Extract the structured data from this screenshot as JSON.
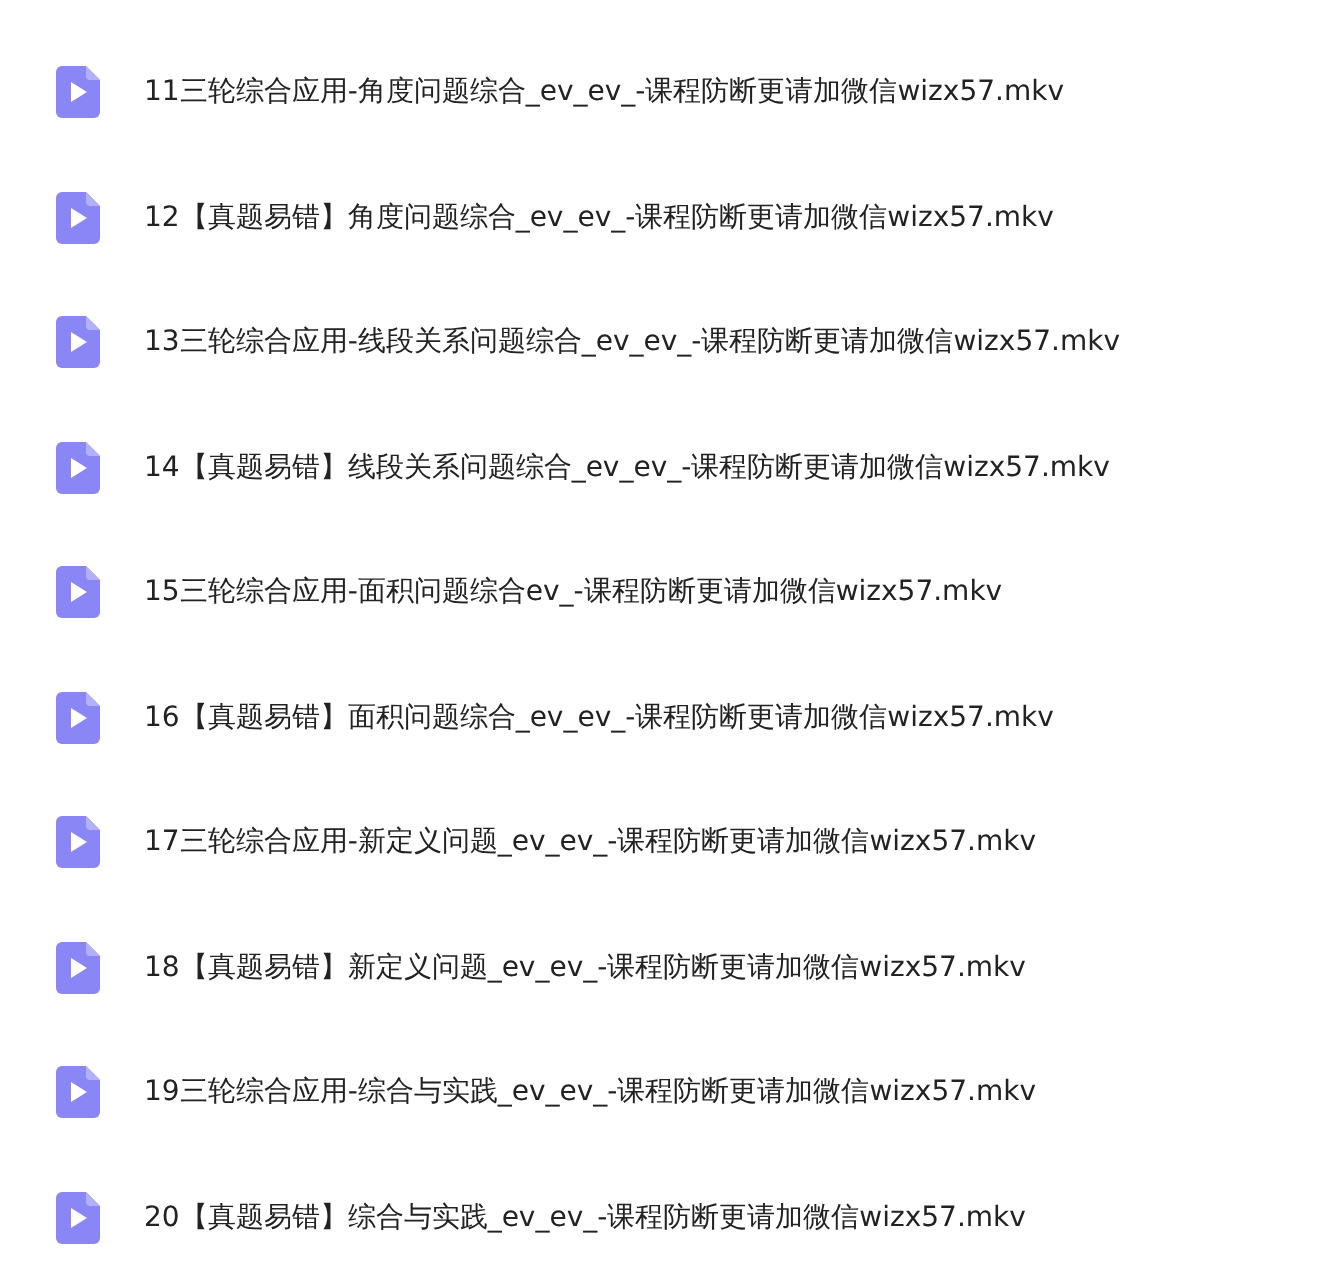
{
  "files": [
    {
      "name": "11三轮综合应用-角度问题综合_ev_ev_-课程防断更请加微信wizx57.mkv",
      "kind": "video"
    },
    {
      "name": "12【真题易错】角度问题综合_ev_ev_-课程防断更请加微信wizx57.mkv",
      "kind": "video"
    },
    {
      "name": "13三轮综合应用-线段关系问题综合_ev_ev_-课程防断更请加微信wizx57.mkv",
      "kind": "video"
    },
    {
      "name": "14【真题易错】线段关系问题综合_ev_ev_-课程防断更请加微信wizx57.mkv",
      "kind": "video"
    },
    {
      "name": "15三轮综合应用-面积问题综合ev_-课程防断更请加微信wizx57.mkv",
      "kind": "video"
    },
    {
      "name": "16【真题易错】面积问题综合_ev_ev_-课程防断更请加微信wizx57.mkv",
      "kind": "video"
    },
    {
      "name": "17三轮综合应用-新定义问题_ev_ev_-课程防断更请加微信wizx57.mkv",
      "kind": "video"
    },
    {
      "name": "18【真题易错】新定义问题_ev_ev_-课程防断更请加微信wizx57.mkv",
      "kind": "video"
    },
    {
      "name": "19三轮综合应用-综合与实践_ev_ev_-课程防断更请加微信wizx57.mkv",
      "kind": "video"
    },
    {
      "name": "20【真题易错】综合与实践_ev_ev_-课程防断更请加微信wizx57.mkv",
      "kind": "video"
    }
  ]
}
